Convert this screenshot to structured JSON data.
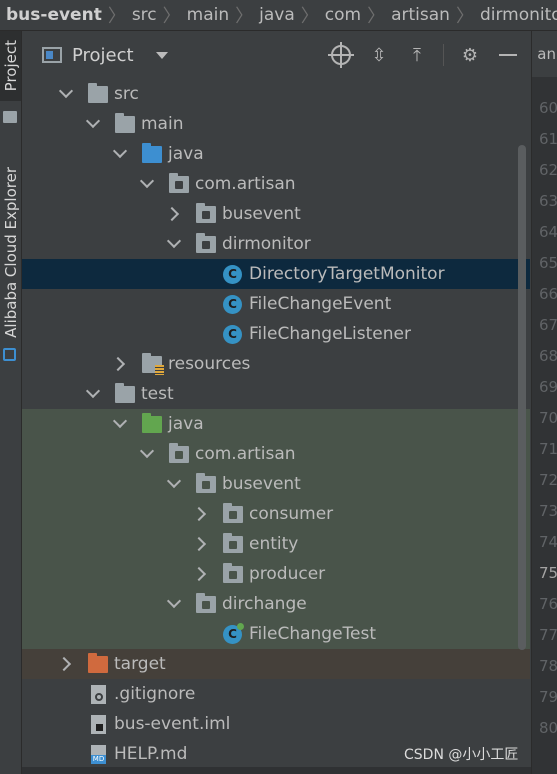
{
  "breadcrumb": [
    "bus-event",
    "src",
    "main",
    "java",
    "com",
    "artisan",
    "dirmonitor"
  ],
  "stripe": {
    "project_tab": "Project",
    "alibaba_tab": "Alibaba Cloud Explorer"
  },
  "tool_window": {
    "title": "Project",
    "actions": [
      "locate-icon",
      "expand-all-icon",
      "collapse-all-icon",
      "gear-icon",
      "hide-icon"
    ]
  },
  "tree": [
    {
      "label": "src",
      "icon": "folder",
      "expanded": true
    },
    {
      "label": "main",
      "icon": "folder",
      "expanded": true
    },
    {
      "label": "java",
      "icon": "source-folder",
      "expanded": true
    },
    {
      "label": "com.artisan",
      "icon": "package",
      "expanded": true
    },
    {
      "label": "busevent",
      "icon": "package",
      "expanded": false
    },
    {
      "label": "dirmonitor",
      "icon": "package",
      "expanded": true
    },
    {
      "label": "DirectoryTargetMonitor",
      "icon": "class",
      "selected": true
    },
    {
      "label": "FileChangeEvent",
      "icon": "class"
    },
    {
      "label": "FileChangeListener",
      "icon": "class"
    },
    {
      "label": "resources",
      "icon": "resources-folder",
      "expanded": false
    },
    {
      "label": "test",
      "icon": "folder",
      "expanded": true
    },
    {
      "label": "java",
      "icon": "test-folder",
      "expanded": true
    },
    {
      "label": "com.artisan",
      "icon": "package",
      "expanded": true
    },
    {
      "label": "busevent",
      "icon": "package",
      "expanded": true
    },
    {
      "label": "consumer",
      "icon": "package",
      "expanded": false
    },
    {
      "label": "entity",
      "icon": "package",
      "expanded": false
    },
    {
      "label": "producer",
      "icon": "package",
      "expanded": false
    },
    {
      "label": "dirchange",
      "icon": "package",
      "expanded": true
    },
    {
      "label": "FileChangeTest",
      "icon": "test-class"
    },
    {
      "label": "target",
      "icon": "excluded-folder",
      "expanded": false
    },
    {
      "label": ".gitignore",
      "icon": "ignore-file"
    },
    {
      "label": "bus-event.iml",
      "icon": "iml-file"
    },
    {
      "label": "HELP.md",
      "icon": "md-file"
    }
  ],
  "gutter": {
    "tab_label": "an",
    "line_numbers": [
      "60",
      "61",
      "62",
      "63",
      "64",
      "65",
      "66",
      "67",
      "68",
      "69",
      "70",
      "71",
      "72",
      "73",
      "74",
      "75",
      "76",
      "77",
      "78",
      "79",
      "80"
    ],
    "active_line": "75"
  },
  "watermark": "CSDN @小小工匠"
}
